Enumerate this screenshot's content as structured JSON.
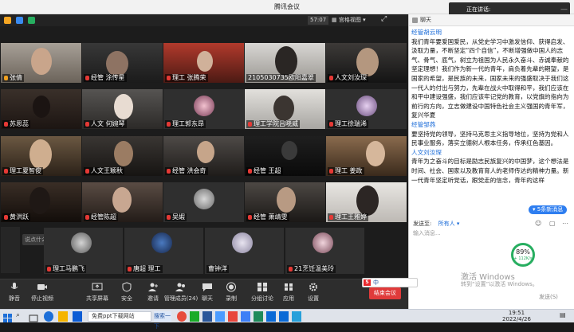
{
  "window": {
    "title": "腾讯会议"
  },
  "toolbar": {
    "timer": "57:07",
    "gallery_label": "宫格视图"
  },
  "speaking": {
    "label": "正在讲话:"
  },
  "participants": [
    {
      "name": "张倩",
      "muted": false
    },
    {
      "name": "经管 涂传星",
      "muted": false
    },
    {
      "name": "理工 张腾荣",
      "muted": true
    },
    {
      "name": "2105030735欧阳嘉翠",
      "muted": false
    },
    {
      "name": "人文刘汝琛",
      "muted": true
    },
    {
      "name": "苏思蕊",
      "muted": true
    },
    {
      "name": "人文 何婉琴",
      "muted": true
    },
    {
      "name": "理工郭东昂",
      "muted": true
    },
    {
      "name": "理工学院吕晓威",
      "muted": true
    },
    {
      "name": "理工徐瑞浠",
      "muted": true
    },
    {
      "name": "理工夏智俊",
      "muted": true
    },
    {
      "name": "人文王颖秋",
      "muted": true
    },
    {
      "name": "经管 洪会奇",
      "muted": true
    },
    {
      "name": "经管 王超",
      "muted": true
    },
    {
      "name": "理工 姜政",
      "muted": true
    },
    {
      "name": "黄洪跃",
      "muted": true
    },
    {
      "name": "经管陈超",
      "muted": true
    },
    {
      "name": "吴嘏",
      "muted": true
    },
    {
      "name": "经管 萧靖雯",
      "muted": true
    },
    {
      "name": "理工王雅婷",
      "muted": true
    },
    {
      "name": "理工马鹏飞",
      "muted": true
    },
    {
      "name": "唐超 理工",
      "muted": true
    },
    {
      "name": "曹钟洋",
      "muted": false
    },
    {
      "name": "21烹饪温美玲",
      "muted": true
    }
  ],
  "overlay_hint": "说点什么...",
  "bottom_toolbar": [
    {
      "label": "静音",
      "icon": "microphone-icon"
    },
    {
      "label": "停止视频",
      "icon": "camera-icon"
    },
    {
      "label": "共享屏幕",
      "icon": "share-screen-icon"
    },
    {
      "label": "安全",
      "icon": "shield-icon"
    },
    {
      "label": "邀请",
      "icon": "invite-icon"
    },
    {
      "label": "管理成员(24)",
      "icon": "members-icon"
    },
    {
      "label": "聊天",
      "icon": "chat-icon"
    },
    {
      "label": "录制",
      "icon": "record-icon"
    },
    {
      "label": "分组讨论",
      "icon": "breakout-icon"
    },
    {
      "label": "应用",
      "icon": "apps-icon"
    },
    {
      "label": "设置",
      "icon": "gear-icon"
    }
  ],
  "end_meeting": "结束会议",
  "chat": {
    "title": "聊天",
    "messages": [
      {
        "sender": "经管胡云明",
        "text": "我们青年要爱国爱民，从党史学习中激发信仰、获得启发、汲取力量，不断坚定“四个自信”，不断增强做中国人的志气、骨气、底气，树立为祖国为人民永久奋斗、赤诚奉献的坚定理想！我们作为新一代的青年，肩负着先辈的期望，是国家的希望，是民族的未来，国家未来的强盛取决于我们这一代人的付出与努力，先辈在战火中取得和平，我们应该在和平中建设强盛，我们应该牢记党的教育，以党旗的指向为前行的方向，立志做建设中国特色社会主义强国的青年军，复兴华夏"
      },
      {
        "sender": "经管邹燕",
        "text": "要坚持党的领导，坚持马克思主义指导地位，坚持为党和人民事业服务，落实立德树人根本任务，传承红色基因。"
      },
      {
        "sender": "人文刘汝琛",
        "text": "青年为之奋斗的目标是励志民族复兴的中国梦，这个想法是时间、社会、国家以及教育育人的老师传达的精神力量。新一代青年坚定听党话，跟党走的信念，青年的这样"
      }
    ],
    "unread": "5条新消息",
    "send_to_label": "发送至:",
    "send_to_value": "所有人",
    "input_placeholder": "输入消息...",
    "send_label": "发送(S)"
  },
  "network": {
    "percent": "89%",
    "speed": "+ 112K/s"
  },
  "watermark": {
    "line1": "激活 Windows",
    "line2": "转到“设置”以激活 Windows。"
  },
  "ime": {
    "label": "中"
  },
  "taskbar": {
    "search_placeholder": "免费ppt下载网站",
    "next_label": "搜索一下",
    "time": "19:51",
    "date": "2022/4/26"
  }
}
